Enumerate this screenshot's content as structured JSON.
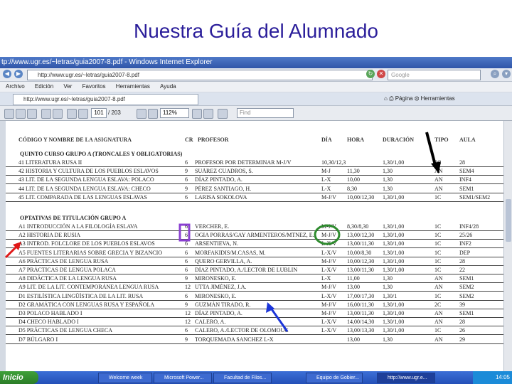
{
  "slide": {
    "title": "Nuestra Guía del Alumnado"
  },
  "browser": {
    "title": "tp://www.ugr.es/~letras/guia2007-8.pdf - Windows Internet Explorer",
    "url": "http://www.ugr.es/~letras/guia2007-8.pdf",
    "search_placeholder": "Google",
    "menu": [
      "Archivo",
      "Edición",
      "Ver",
      "Favoritos",
      "Herramientas",
      "Ayuda"
    ],
    "tab_label": "http://www.ugr.es/~letras/guia2007-8.pdf",
    "tools": [
      "Página",
      "Herramientas"
    ]
  },
  "pdf_toolbar": {
    "page": "101",
    "page_total": "/ 203",
    "zoom": "112%",
    "find": "Find"
  },
  "table": {
    "headers": [
      "CÓDIGO Y NOMBRE DE LA ASIGNATURA",
      "CR",
      "PROFESOR",
      "DÍA",
      "HORA",
      "DURACIÓN",
      "TIPO",
      "AULA"
    ],
    "section1": "QUINTO CURSO GRUPO A (TRONCALES Y OBLIGATORIAS)",
    "rows1": [
      [
        "41 LITERATURA RUSA II",
        "6",
        "PROFESOR POR DETERMINAR M-J/V",
        "10,30/12,30",
        "",
        "1,30/1,00",
        "2C",
        "28"
      ],
      [
        "42 HISTORIA Y CULTURA DE LOS PUEBLOS ESLAVOS",
        "9",
        "SUÁREZ CUADROS, S.",
        "M-J",
        "11,30",
        "1,30",
        "AN",
        "SEM4"
      ],
      [
        "43 LIT. DE LA SEGUNDA LENGUA ESLAVA: POLACO",
        "6",
        "DÍAZ PINTADO, A.",
        "L-X",
        "10,00",
        "1,30",
        "AN",
        "INF4"
      ],
      [
        "44 LIT. DE LA SEGUNDA LENGUA ESLAVA: CHECO",
        "9",
        "PÉREZ SANTIAGO, H.",
        "L-X",
        "8,30",
        "1,30",
        "AN",
        "SEM1"
      ],
      [
        "45 LIT. COMPARADA DE LAS LENGUAS ESLAVAS",
        "6",
        "LARISA SOKOLOVA",
        "M-J/V",
        "10,00/12,30",
        "1,30/1,00",
        "1C",
        "SEM1/SEM2"
      ]
    ],
    "section2": "OPTATIVAS DE TITULACIÓN GRUPO A",
    "rows2": [
      [
        "A1 INTRODUCCIÓN A LA FILOLOGÍA ESLAVA",
        "6",
        "VERCHER, E.",
        "M-J/V",
        "8,30/8,30",
        "1,30/1,00",
        "1C",
        "INF4/28"
      ],
      [
        "A2 HISTORIA DE RUSIA",
        "6",
        "OGIA PORRAS/GAY ARMENTEROS/MTNEZ, E.",
        "M-J/V",
        "13,00/12,30",
        "1,30/1,00",
        "1C",
        "25/26"
      ],
      [
        "A3 INTROD. FOLCLORE DE LOS PUEBLOS ESLAVOS",
        "6",
        "ARSENTIEVA, N.",
        "L-X/V",
        "13,00/11,30",
        "1,30/1,00",
        "1C",
        "INF2"
      ],
      [
        "A5 FUENTES LITERARIAS SOBRE GRECIA Y BIZANCIO",
        "6",
        "MORFAKIDIS/M.CASAS, M.",
        "L-X/V",
        "10,00/8,30",
        "1,30/1,00",
        "1C",
        "DEP"
      ],
      [
        "A6 PRÁCTICAS DE LENGUA RUSA",
        "6",
        "QUERO GERVILLA, A.",
        "M-J/V",
        "10,00/12,30",
        "1,30/1,00",
        "1C",
        "28"
      ],
      [
        "A7 PRÁCTICAS DE LENGUA POLACA",
        "6",
        "DÍAZ PINTADO, A./LECTOR DE LUBLIN",
        "L-X/V",
        "13,00/11,30",
        "1,30/1,00",
        "1C",
        "22"
      ],
      [
        "A8 DIDÁCTICA DE LA LENGUA RUSA",
        "9",
        "MIRONESKO, E.",
        "L-X",
        "11,00",
        "1,30",
        "AN",
        "SEM1"
      ],
      [
        "A9 LIT. DE LA LIT. CONTEMPORÁNEA LENGUA RUSA",
        "12",
        "UTTA JIMÉNEZ, J.A.",
        "M-J/V",
        "13,00",
        "1,30",
        "AN",
        "SEM2"
      ],
      [
        "D1 ESTILÍSTICA LINGÜÍSTICA DE LA LIT. RUSA",
        "6",
        "MIRONESKO, E.",
        "L-X/V",
        "17,00/17,30",
        "1,30/1",
        "1C",
        "SEM2"
      ],
      [
        "D2 GRAMÁTICA CON LENGUAS RUSA Y ESPAÑOLA",
        "9",
        "GUZMÁN TIRADO, R.",
        "M-J/V",
        "16,00/11,30",
        "1,30/1,00",
        "2C",
        "39"
      ],
      [
        "D3 POLACO HABLADO I",
        "12",
        "DÍAZ PINTADO, A.",
        "M-J/V",
        "13,00/11,30",
        "1,30/1,00",
        "AN",
        "SEM1"
      ],
      [
        "D4 CHECO HABLADO I",
        "12",
        "CALERO, A.",
        "L-X/V",
        "14,00/14,30",
        "1,30/1,00",
        "AN",
        "28"
      ],
      [
        "D5 PRÁCTICAS DE LENGUA CHECA",
        "6",
        "CALERO, A./LECTOR DE OLOMOUC",
        "L-X/V",
        "13,00/13,30",
        "1,30/1,00",
        "1C",
        "26"
      ],
      [
        "D7 BÚLGARO I",
        "9",
        "TORQUEMADA SANCHEZ  L-X",
        "",
        "13,00",
        "1,30",
        "AN",
        "29"
      ]
    ]
  },
  "taskbar": {
    "start": "Inicio",
    "tasks": [
      "Welcome week",
      "Microsoft Power...",
      "Facultad de Filos...",
      "Equipo de Gobier...",
      "http://www.ugr.e..."
    ],
    "clock": "14:05"
  },
  "colors": {
    "title": "#2a1d9a",
    "black_arrow": "#000000",
    "red_arrow": "#e01818",
    "blue_arrow": "#1b35d9",
    "green_ellipse": "#2e8b2e",
    "purple_box": "#8a3fd1"
  }
}
